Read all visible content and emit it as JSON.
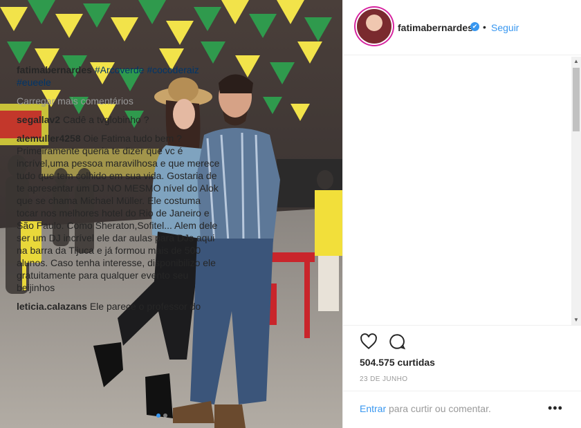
{
  "post": {
    "username": "fatimabernardes",
    "verified_glyph": "✔",
    "dot": "•",
    "follow_label": "Seguir",
    "caption_tags": [
      "#Arcoverde",
      "#cocoderaiz",
      "#eueele"
    ],
    "load_more": "Carregar mais comentários",
    "comments": [
      {
        "user": "segallav2",
        "text": "Cadê a tvglobinho ?"
      },
      {
        "user": "alemuller4258",
        "text": "Oie Fatima tudo bem ? Primeiramente queria te dizer que vc é incrível,uma pessoa maravilhosa e que merece tudo que tem colhido em sua vida. Gostaria de te apresentar um DJ NO MESMO nível do Alok que se chama Michael Müller. Ele costuma tocar nos melhores hotel do Rio de Janeiro e São Paulo. Como Sheraton,Sofitel... Alem dele ser um DJ incrível ele dar aulas para DJs aqui na barra da Tijuca e já formou mais de 500 alunos. Caso tenha interesse, disponibilizo ele gratuitamente para qualquer evento seu beijinhos"
      },
      {
        "user": "leticia.calazans",
        "text": "Ele parece o professor do"
      }
    ],
    "likes": "504.575 curtidas",
    "date": "23 DE JUNHO",
    "login_link": "Entrar",
    "login_rest": " para curtir ou comentar.",
    "more_glyph": "•••"
  },
  "icons": {
    "heart": "heart-icon",
    "comment": "comment-icon",
    "verified": "verified-badge-icon",
    "more": "more-options-icon"
  },
  "colors": {
    "link_blue": "#3897f0",
    "hashtag": "#003569",
    "muted": "#999999"
  }
}
